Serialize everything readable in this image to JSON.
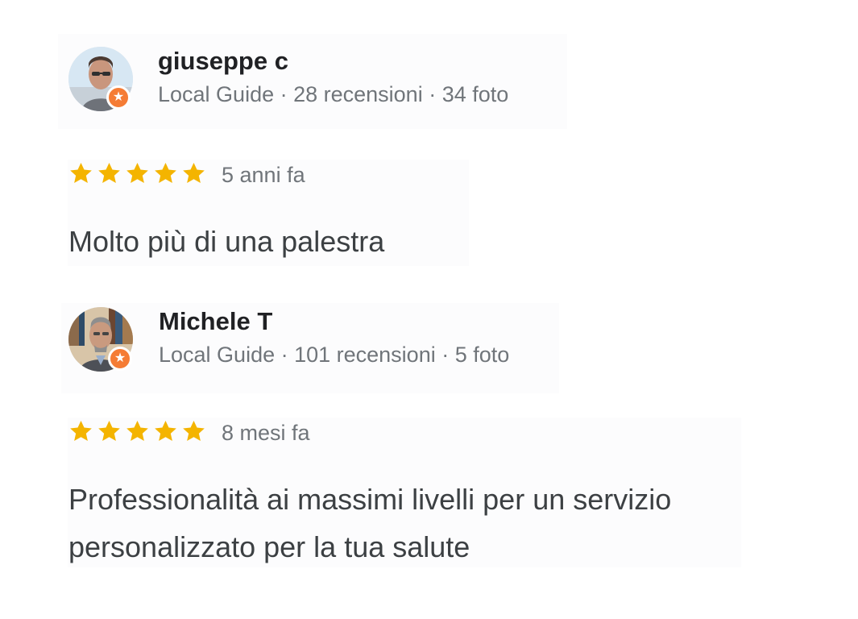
{
  "reviews": [
    {
      "author": "giuseppe c",
      "meta": "Local Guide · 28 recensioni · 34 foto",
      "rating": 5,
      "max_rating": 5,
      "time": "5 anni fa",
      "text": "Molto più di una palestra",
      "avatar_icon": "user-avatar-icon",
      "badge_icon": "local-guide-badge-icon"
    },
    {
      "author": "Michele T",
      "meta": "Local Guide · 101 recensioni · 5 foto",
      "rating": 5,
      "max_rating": 5,
      "time": "8 mesi fa",
      "text": "Professionalità ai massimi livelli per un servizio personalizzato per la tua salute",
      "avatar_icon": "user-avatar-icon",
      "badge_icon": "local-guide-badge-icon"
    }
  ],
  "colors": {
    "star": "#f4b400",
    "badge": "#f57c35",
    "name": "#202124",
    "meta": "#70757a",
    "text": "#3c4043"
  }
}
